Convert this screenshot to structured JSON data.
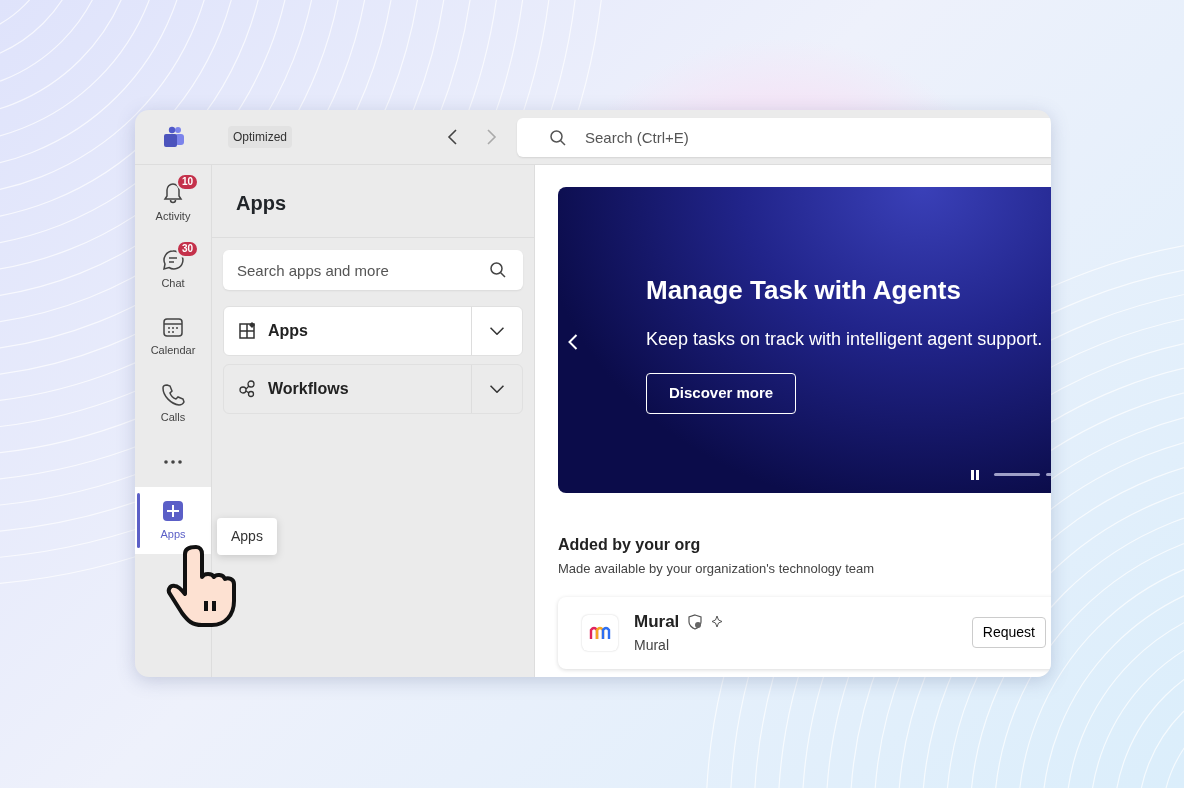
{
  "titlebar": {
    "mode_label": "Optimized",
    "search": {
      "placeholder": "Search (Ctrl+E)"
    }
  },
  "rail": {
    "items": [
      {
        "label": "Activity",
        "badge": "10",
        "selected": false,
        "kind": "bell"
      },
      {
        "label": "Chat",
        "badge": "30",
        "selected": false,
        "kind": "chat"
      },
      {
        "label": "Calendar",
        "selected": false,
        "kind": "calendar"
      },
      {
        "label": "Calls",
        "selected": false,
        "kind": "phone"
      },
      {
        "selected": false,
        "kind": "more"
      },
      {
        "label": "Apps",
        "selected": true,
        "kind": "apps"
      }
    ]
  },
  "tooltip": "Apps",
  "panel": {
    "title": "Apps",
    "search": {
      "placeholder": "Search apps and more"
    },
    "sections": [
      {
        "label": "Apps",
        "kind": "apps",
        "expanded": false,
        "highlighted": true
      },
      {
        "label": "Workflows",
        "kind": "workflows",
        "expanded": false,
        "highlighted": false
      }
    ]
  },
  "banner": {
    "title": "Manage Task with Agents",
    "subtitle": "Keep tasks on track with intelligent agent support.",
    "button": "Discover more",
    "paused": true
  },
  "org_section": {
    "title": "Added by your org",
    "subtitle": "Made available by your organization's technology team",
    "apps": [
      {
        "name": "Mural",
        "publisher": "Mural",
        "action": "Request"
      }
    ]
  }
}
